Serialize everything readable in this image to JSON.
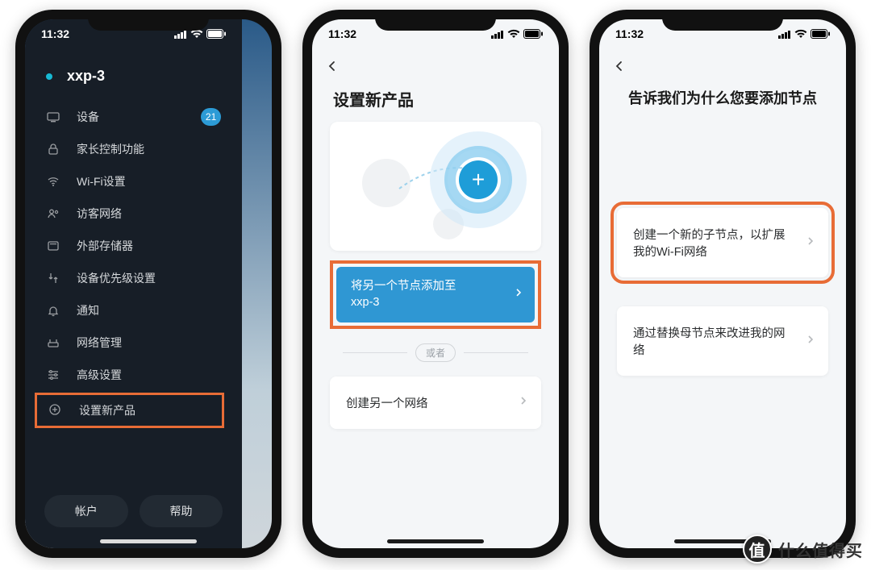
{
  "status": {
    "time": "11:32"
  },
  "phone1": {
    "network_name": "xxp-3",
    "menu": {
      "devices": "设备",
      "devices_badge": "21",
      "parental": "家长控制功能",
      "wifi": "Wi-Fi设置",
      "guest": "访客网络",
      "storage": "外部存储器",
      "priority": "设备优先级设置",
      "notify": "通知",
      "netmgmt": "网络管理",
      "advanced": "高级设置",
      "setup_new": "设置新产品"
    },
    "account_btn": "帐户",
    "help_btn": "帮助"
  },
  "phone2": {
    "title": "设置新产品",
    "add_node_line1": "将另一个节点添加至",
    "add_node_line2": "xxp-3",
    "or": "或者",
    "create_other": "创建另一个网络"
  },
  "phone3": {
    "title": "告诉我们为什么您要添加节点",
    "opt1": "创建一个新的子节点，以扩展我的Wi-Fi网络",
    "opt2": "通过替换母节点来改进我的网络"
  },
  "watermark": {
    "char": "值",
    "text": "什么值得买"
  }
}
